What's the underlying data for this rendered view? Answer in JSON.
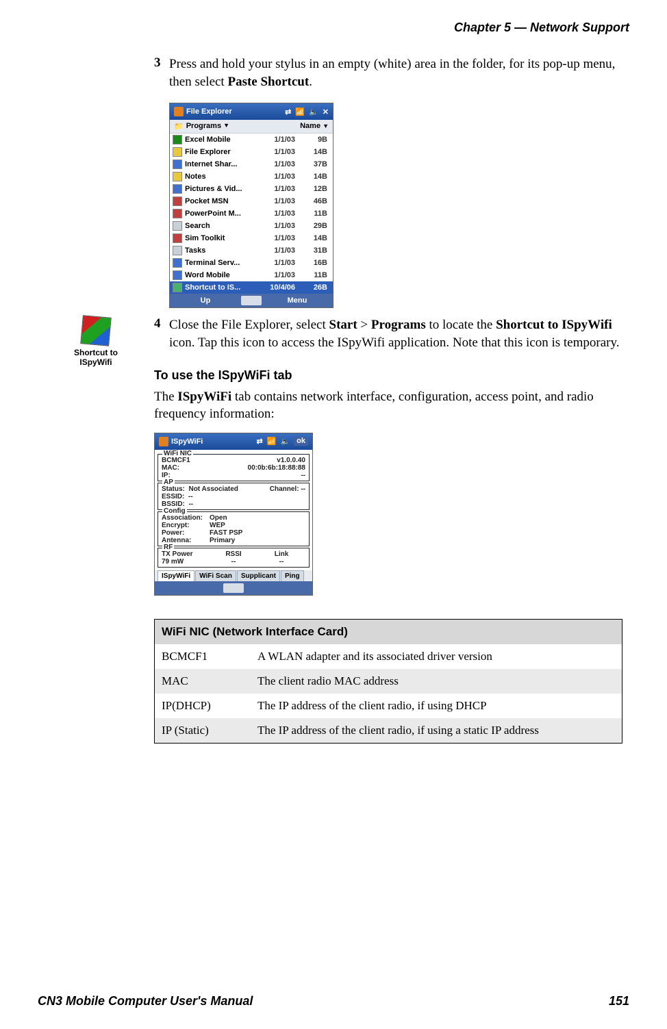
{
  "header": {
    "chapter": "Chapter 5 —  Network Support"
  },
  "footer": {
    "left": "CN3 Mobile Computer User's Manual",
    "right": "151"
  },
  "steps": {
    "s3": {
      "num": "3",
      "text_a": "Press and hold your stylus in an empty (white) area in the folder, for its pop-up menu, then select ",
      "text_b": "Paste Shortcut",
      "text_c": "."
    },
    "s4": {
      "num": "4",
      "text_a": "Close the File Explorer, select ",
      "b1": "Start",
      "gt": " > ",
      "b2": "Programs",
      "text_b": " to locate the ",
      "b3": "Shortcut to ISpyWifi",
      "text_c": " icon. Tap this icon to access the ISpyWifi application. Note that this icon is temporary."
    }
  },
  "shortcut_label": "Shortcut to ISpyWifi",
  "heading": "To use the ISpyWiFi tab",
  "desc": {
    "a": "The ",
    "b": "ISpyWiFi",
    "c": " tab contains network interface, configuration, access point, and radio frequency information:"
  },
  "fe": {
    "title": "File Explorer",
    "loc": "Programs",
    "sort": "Name",
    "bottom_left": "Up",
    "bottom_right": "Menu",
    "rows": [
      {
        "name": "Excel Mobile",
        "date": "1/1/03",
        "size": "9B",
        "ic": "ic-green"
      },
      {
        "name": "File Explorer",
        "date": "1/1/03",
        "size": "14B",
        "ic": "ic-yellow"
      },
      {
        "name": "Internet Shar...",
        "date": "1/1/03",
        "size": "37B",
        "ic": "ic-blue"
      },
      {
        "name": "Notes",
        "date": "1/1/03",
        "size": "14B",
        "ic": "ic-yellow"
      },
      {
        "name": "Pictures & Vid...",
        "date": "1/1/03",
        "size": "12B",
        "ic": "ic-blue"
      },
      {
        "name": "Pocket MSN",
        "date": "1/1/03",
        "size": "46B",
        "ic": "ic-red"
      },
      {
        "name": "PowerPoint M...",
        "date": "1/1/03",
        "size": "11B",
        "ic": "ic-red"
      },
      {
        "name": "Search",
        "date": "1/1/03",
        "size": "29B",
        "ic": "ic-gray"
      },
      {
        "name": "Sim Toolkit",
        "date": "1/1/03",
        "size": "14B",
        "ic": "ic-red"
      },
      {
        "name": "Tasks",
        "date": "1/1/03",
        "size": "31B",
        "ic": "ic-gray"
      },
      {
        "name": "Terminal Serv...",
        "date": "1/1/03",
        "size": "16B",
        "ic": "ic-blue"
      },
      {
        "name": "Word Mobile",
        "date": "1/1/03",
        "size": "11B",
        "ic": "ic-blue"
      }
    ],
    "sel": {
      "name": "Shortcut to IS...",
      "date": "10/4/06",
      "size": "26B"
    }
  },
  "iw": {
    "title": "ISpyWiFi",
    "ok": "ok",
    "nic": {
      "legend": "WiFi NIC",
      "adapter": "BCMCF1",
      "ver": "v1.0.0.40",
      "mac_k": "MAC:",
      "mac_v": "00:0b:6b:18:88:88",
      "ip_k": "IP:",
      "ip_v": "--"
    },
    "ap": {
      "legend": "AP",
      "status_k": "Status:",
      "status_v": "Not Associated",
      "channel_k": "Channel:",
      "channel_v": "--",
      "essid_k": "ESSID:",
      "essid_v": "--",
      "bssid_k": "BSSID:",
      "bssid_v": "--"
    },
    "cfg": {
      "legend": "Config",
      "assoc_k": "Association:",
      "assoc_v": "Open",
      "enc_k": "Encrypt:",
      "enc_v": "WEP",
      "pwr_k": "Power:",
      "pwr_v": "FAST PSP",
      "ant_k": "Antenna:",
      "ant_v": "Primary"
    },
    "rf": {
      "legend": "RF",
      "txp_k": "TX Power",
      "txp_v": "79 mW",
      "rssi_k": "RSSI",
      "rssi_v": "--",
      "link_k": "Link",
      "link_v": "--"
    },
    "tabs": [
      "ISpyWiFi",
      "WiFi Scan",
      "Supplicant",
      "Ping"
    ]
  },
  "table": {
    "header": "WiFi NIC (Network Interface Card)",
    "rows": [
      {
        "k": "BCMCF1",
        "v": "A WLAN adapter and its associated driver version"
      },
      {
        "k": "MAC",
        "v": "The client radio MAC address"
      },
      {
        "k": "IP(DHCP)",
        "v": "The IP address of the client radio, if using DHCP"
      },
      {
        "k": "IP (Static)",
        "v": "The IP address of the client radio, if using a static IP address"
      }
    ]
  }
}
